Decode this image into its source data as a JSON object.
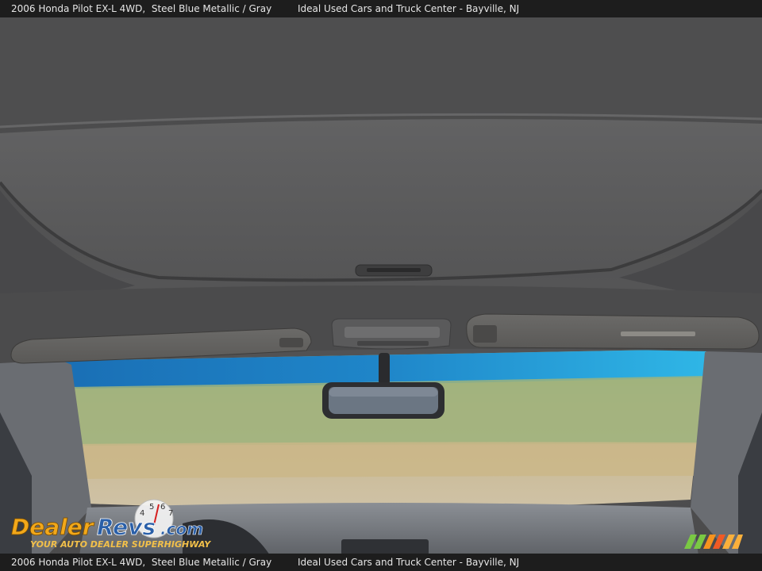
{
  "caption": {
    "vehicle": "2006 Honda Pilot EX-L 4WD,  Steel Blue Metallic / Gray",
    "dealer": "Ideal Used Cars and Truck Center - Bayville, NJ"
  },
  "watermark": {
    "brand": "DealerRevs.com",
    "tagline": "Your Auto Dealer SuperHighway",
    "colors": {
      "gold": "#f2a81a",
      "blue": "#2a5fa8",
      "white": "#ffffff"
    }
  },
  "colors": {
    "headliner": "#4f4f50",
    "sunroof_panel": "#5b5b5c",
    "sky": "#1aa3d6",
    "trees": "#8aa86a",
    "ground": "#c9b38a",
    "bar": "#1d1d1d",
    "bar_text": "#e6e6e6",
    "accent_stripes": [
      "#7ac943",
      "#f7931e",
      "#f15a24",
      "#fbb03b"
    ]
  }
}
